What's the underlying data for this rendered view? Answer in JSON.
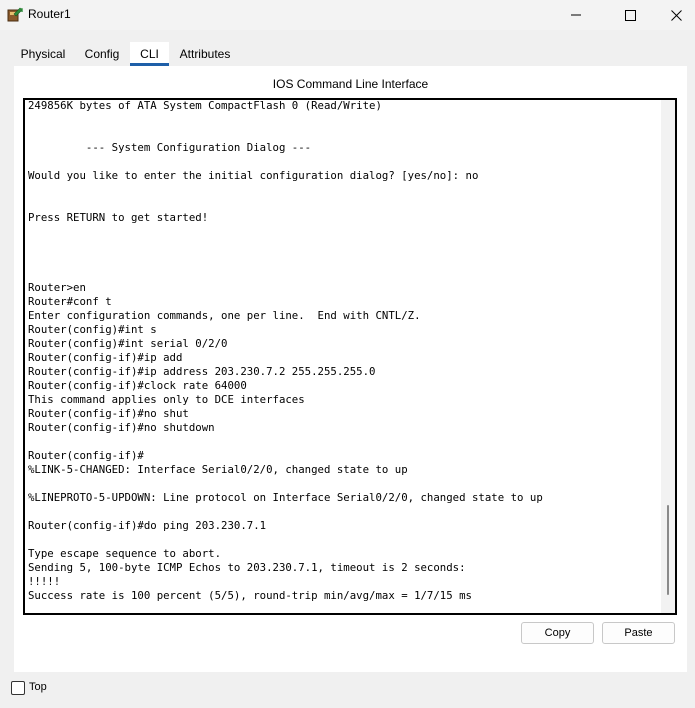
{
  "window": {
    "title": "Router1",
    "icon": "router-icon",
    "controls": [
      "minimize-icon",
      "maximize-icon",
      "close-icon"
    ]
  },
  "tabs": [
    {
      "label": "Physical",
      "active": false
    },
    {
      "label": "Config",
      "active": false
    },
    {
      "label": "CLI",
      "active": true
    },
    {
      "label": "Attributes",
      "active": false
    }
  ],
  "cli": {
    "heading": "IOS Command Line Interface",
    "text": "249856K bytes of ATA System CompactFlash 0 (Read/Write)\n\n\n         --- System Configuration Dialog ---\n\nWould you like to enter the initial configuration dialog? [yes/no]: no\n\n\nPress RETURN to get started!\n\n\n\n\nRouter>en\nRouter#conf t\nEnter configuration commands, one per line.  End with CNTL/Z.\nRouter(config)#int s\nRouter(config)#int serial 0/2/0\nRouter(config-if)#ip add\nRouter(config-if)#ip address 203.230.7.2 255.255.255.0\nRouter(config-if)#clock rate 64000\nThis command applies only to DCE interfaces\nRouter(config-if)#no shut\nRouter(config-if)#no shutdown\n\nRouter(config-if)#\n%LINK-5-CHANGED: Interface Serial0/2/0, changed state to up\n\n%LINEPROTO-5-UPDOWN: Line protocol on Interface Serial0/2/0, changed state to up\n\nRouter(config-if)#do ping 203.230.7.1\n\nType escape sequence to abort.\nSending 5, 100-byte ICMP Echos to 203.230.7.1, timeout is 2 seconds:\n!!!!!\nSuccess rate is 100 percent (5/5), round-trip min/avg/max = 1/7/15 ms\n\nRouter(config-if)#",
    "copy_label": "Copy",
    "paste_label": "Paste"
  },
  "footer": {
    "top_label": "Top",
    "top_checked": false
  },
  "colors": {
    "active_tab_underline": "#1e5fa8",
    "terminal_border": "#000000",
    "window_background": "#f0f0f0"
  }
}
